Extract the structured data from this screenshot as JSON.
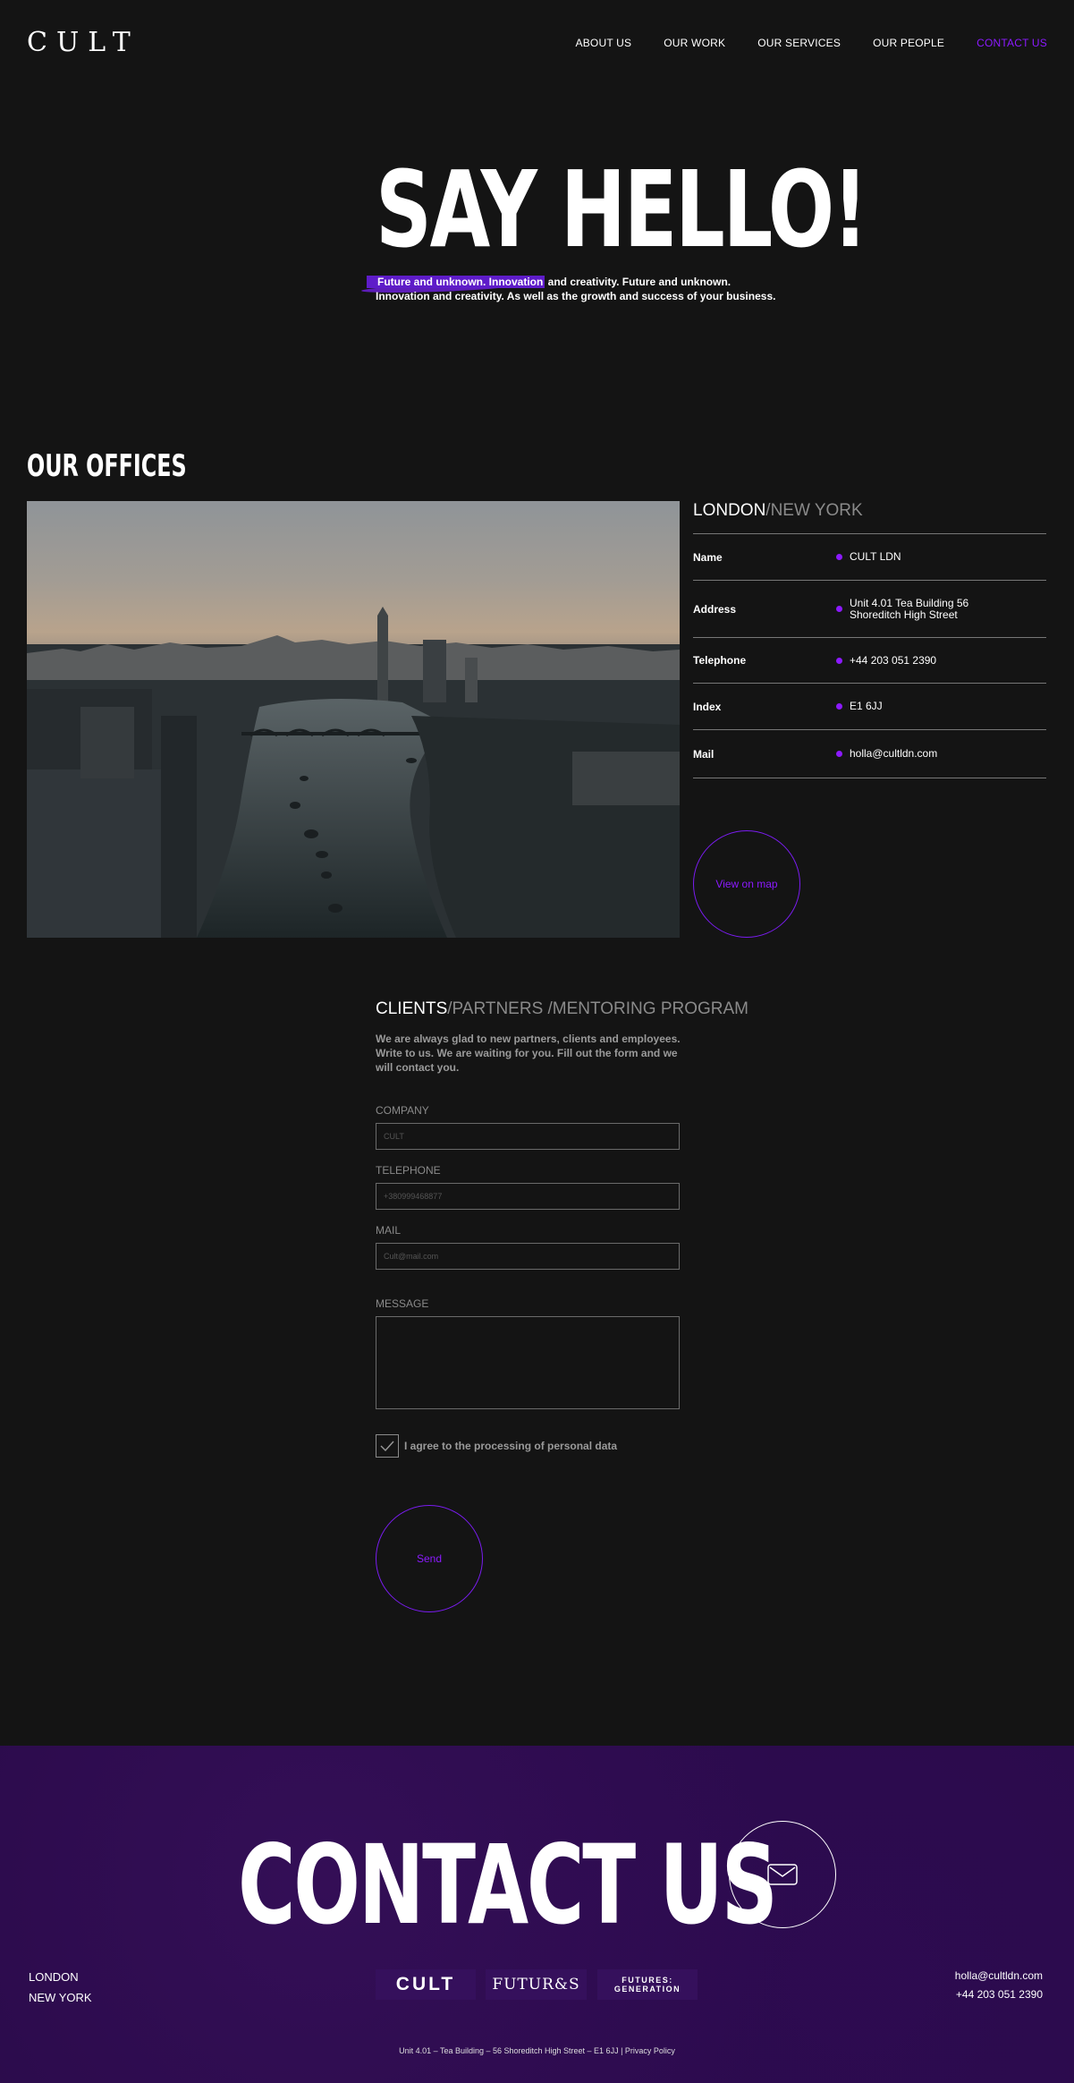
{
  "brand": "CULT",
  "nav": [
    "ABOUT US",
    "OUR WORK",
    "OUR SERVICES",
    "OUR PEOPLE",
    "CONTACT US"
  ],
  "hero": {
    "title": "SAY HELLO!",
    "highlight": "Future and unknown. Innovation",
    "text": " and creativity. Future and unknown. Innovation and creativity. As well as the growth and success of your business."
  },
  "offices": {
    "title": "OUR OFFICES",
    "tab_current": "LONDON",
    "tab_other": "/NEW YORK",
    "rows": [
      {
        "label": "Name",
        "value": "CULT LDN"
      },
      {
        "label": "Address",
        "value": "Unit 4.01 Tea Building 56\nShoreditch High Street"
      },
      {
        "label": "Telephone",
        "value": "+44 203 051 2390"
      },
      {
        "label": "Index",
        "value": "E1 6JJ"
      },
      {
        "label": "Mail",
        "value": "holla@cultldn.com"
      }
    ],
    "map_button": "View on map"
  },
  "form": {
    "tab_current": "CLIENTS",
    "tab_other": "/PARTNERS /MENTORING PROGRAM",
    "intro": "We are always glad to new partners, clients and employees. Write to us. We are waiting for you. Fill out the form and we will contact you.",
    "company_label": "COMPANY",
    "company_placeholder": "CULT",
    "telephone_label": "TELEPHONE",
    "telephone_placeholder": "+380999468877",
    "mail_label": "MAIL",
    "mail_placeholder": "Cult@mail.com",
    "message_label": "MESSAGE",
    "agree": "I agree to the processing of personal data",
    "send": "Send"
  },
  "footer": {
    "title": "CONTACT US",
    "cities": [
      "LONDON",
      "NEW YORK"
    ],
    "logos": {
      "cult": "CULT",
      "futures": "FUTUR&S",
      "gen_line1": "FUTURES:",
      "gen_line2": "GENERATION"
    },
    "email": "holla@cultldn.com",
    "phone": "+44 203 051 2390",
    "address": "Unit 4.01 – Tea Building – 56 Shoreditch High Street – E1 6JJ | Privacy Policy"
  },
  "colors": {
    "accent": "#8c1aff",
    "background": "#141414",
    "footer": "#2a0b4a"
  }
}
